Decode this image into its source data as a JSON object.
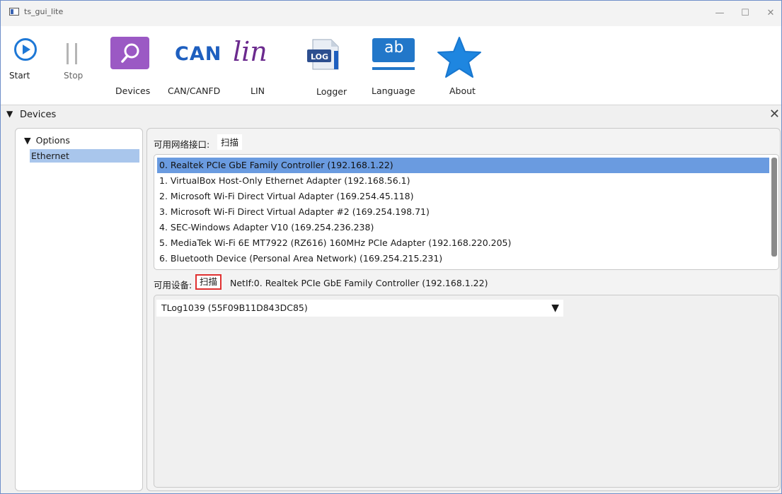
{
  "window": {
    "title": "ts_gui_lite",
    "minimize": "—",
    "maximize": "☐",
    "close": "✕"
  },
  "toolbar": {
    "start_label": "Start",
    "stop_label": "Stop",
    "devices_label": "Devices",
    "can_label": "CAN/CANFD",
    "can_icon_text": "CAN",
    "lin_label": "LIN",
    "lin_icon_text": "lin",
    "logger_label": "Logger",
    "logger_icon_text": "LOG",
    "language_label": "Language",
    "language_icon_text": "ab",
    "about_label": "About"
  },
  "section": {
    "toggle": "▼",
    "title": "Devices",
    "close": "✕"
  },
  "tree": {
    "toggle": "▼",
    "options_label": "Options",
    "ethernet_label": "Ethernet"
  },
  "interfaces": {
    "label": "可用网络接口:",
    "scan_label": "扫描",
    "items": [
      "0. Realtek PCIe GbE Family Controller (192.168.1.22)",
      "1. VirtualBox Host-Only Ethernet Adapter (192.168.56.1)",
      "2. Microsoft Wi-Fi Direct Virtual Adapter (169.254.45.118)",
      "3. Microsoft Wi-Fi Direct Virtual Adapter #2 (169.254.198.71)",
      "4. SEC-Windows Adapter V10 (169.254.236.238)",
      "5. MediaTek Wi-Fi 6E MT7922 (RZ616) 160MHz PCIe Adapter (192.168.220.205)",
      "6. Bluetooth Device (Personal Area Network) (169.254.215.231)"
    ],
    "selected_index": 0
  },
  "devices": {
    "label": "可用设备:",
    "scan_label": "扫描",
    "netif_text": "NetIf:0. Realtek PCIe GbE Family Controller (192.168.1.22)",
    "selected_device": "TLog1039 (55F09B11D843DC85)",
    "dropdown_arrow": "▼"
  },
  "colors": {
    "selection": "#6a9be0",
    "tree_selection": "#a9c6ec",
    "devices_icon_bg": "#9b59c4",
    "can_blue": "#1e5fbf",
    "lin_purple": "#6b2a8e",
    "language_blue": "#2277c9",
    "about_star": "#1e86e0",
    "scan_highlight": "#e03030"
  }
}
